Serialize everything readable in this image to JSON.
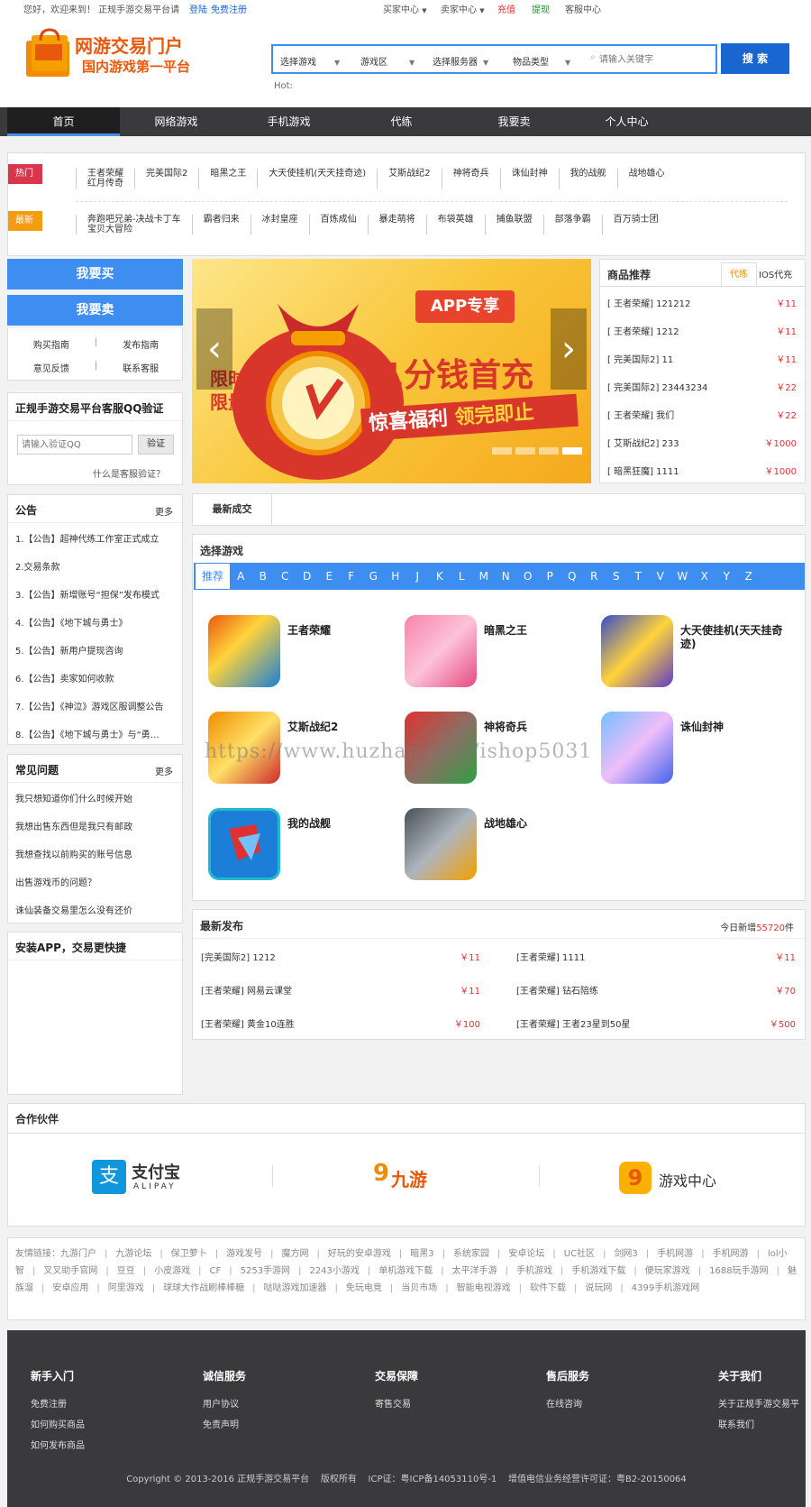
{
  "topbar": {
    "welcome": "您好，欢迎来到！ 正规手游交易平台请",
    "login": "登陆",
    "register": "免费注册",
    "buyer_center": "买家中心",
    "seller_center": "卖家中心",
    "recharge": "充值",
    "withdraw": "提现",
    "service_center": "客服中心"
  },
  "header": {
    "logo_title": "网游交易门户",
    "logo_subtitle": "国内游戏第一平台",
    "search": {
      "game_select": "选择游戏",
      "zone_select": "游戏区",
      "server_select": "选择服务器",
      "type_select": "物品类型",
      "placeholder": "请输入关键字",
      "button": "搜 索",
      "hot_label": "Hot:"
    }
  },
  "nav": [
    "首页",
    "网络游戏",
    "手机游戏",
    "代练",
    "我要卖",
    "个人中心"
  ],
  "hot": {
    "hot_label": "热门",
    "new_label": "最新",
    "hot_items": [
      "王者荣耀",
      "完美国际2",
      "暗黑之王",
      "大天使挂机(天天挂奇迹)",
      "艾斯战纪2",
      "神将奇兵",
      "诛仙封神",
      "我的战舰",
      "战地雄心"
    ],
    "hot_first_sub": "红月传奇",
    "new_items": [
      "奔跑吧兄弟-决战卡丁车",
      "霸者归来",
      "冰封皇座",
      "百炼成仙",
      "暴走萌将",
      "布袋英雄",
      "捕鱼联盟",
      "部落争霸",
      "百万骑士团"
    ],
    "new_first_sub": "宝贝大冒险"
  },
  "left": {
    "buy": "我要买",
    "sell": "我要卖",
    "links": [
      "购买指南",
      "发布指南",
      "意见反馈",
      "联系客服"
    ],
    "qq_title": "正规手游交易平台客服QQ验证",
    "qq_placeholder": "请输入验证QQ",
    "qq_button": "验证",
    "qq_help": "什么是客服验证？",
    "notice_title": "公告",
    "more": "更多",
    "notices": [
      "1.【公告】超神代练工作室正式成立",
      "2.交易条款",
      "3.【公告】新增账号“担保”发布模式",
      "4.【公告】《地下城与勇士》",
      "5.【公告】新用户提现咨询",
      "6.【公告】卖家如何收款",
      "7.【公告】《神泣》游戏区服调整公告",
      "8.【公告】《地下城与勇士》与“勇…"
    ],
    "faq_title": "常见问题",
    "faqs": [
      "我只想知道你们什么时候开始",
      "我想出售东西但是我只有邮政",
      "我想查找以前购买的账号信息",
      "出售游戏币的问题？",
      "诛仙装备交易里怎么没有还价"
    ],
    "app_title": "安装APP，交易更快捷"
  },
  "banner": {
    "badge": "APP专享",
    "headline": "1分钱首充",
    "sub": "惊喜福利",
    "sub2": "领完即止",
    "tag1": "限时",
    "tag2": "限量"
  },
  "recommend": {
    "title": "商品推荐",
    "tab1": "代练",
    "tab2": "IOS代充",
    "items": [
      {
        "name": "[ 王者荣耀] 121212",
        "price": "￥11"
      },
      {
        "name": "[ 王者荣耀] 1212",
        "price": "￥11"
      },
      {
        "name": "[ 完美国际2] 11",
        "price": "￥11"
      },
      {
        "name": "[ 完美国际2] 23443234",
        "price": "￥22"
      },
      {
        "name": "[ 王者荣耀] 我们",
        "price": "￥22"
      },
      {
        "name": "[ 艾斯战纪2] 233",
        "price": "￥1000"
      },
      {
        "name": "[ 暗黑狂魔] 1111",
        "price": "￥1000"
      }
    ]
  },
  "deals_tab": "最新成交",
  "select_game": {
    "title": "选择游戏",
    "recommend": "推荐",
    "letters": [
      "A",
      "B",
      "C",
      "D",
      "E",
      "F",
      "G",
      "H",
      "J",
      "K",
      "L",
      "M",
      "N",
      "O",
      "P",
      "Q",
      "R",
      "S",
      "T",
      "V",
      "W",
      "X",
      "Y",
      "Z"
    ],
    "games": [
      "王者荣耀",
      "暗黑之王",
      "大天使挂机(天天挂奇迹)",
      "艾斯战纪2",
      "神将奇兵",
      "诛仙封神",
      "我的战舰",
      "战地雄心"
    ],
    "watermark": "https://www.huzhan.com/ishop5031"
  },
  "latest": {
    "title": "最新发布",
    "today_prefix": "今日新增",
    "today_count": "55720",
    "today_suffix": "件",
    "left": [
      {
        "name": "[完美国际2] 1212",
        "price": "￥11"
      },
      {
        "name": "[王者荣耀] 网易云课堂",
        "price": "￥11"
      },
      {
        "name": "[王者荣耀] 黄金10连胜",
        "price": "￥100"
      }
    ],
    "right": [
      {
        "name": "[王者荣耀] 1111",
        "price": "￥11"
      },
      {
        "name": "[王者荣耀] 钻石陪练",
        "price": "￥70"
      },
      {
        "name": "[王者荣耀] 王者23星到50星",
        "price": "￥500"
      }
    ]
  },
  "partners": {
    "title": "合作伙伴",
    "alipay": "支付宝",
    "alipay_en": "ALIPAY",
    "jiuyou": "九游",
    "game_center": "游戏中心"
  },
  "friend_links": {
    "label": "友情链接：",
    "items": [
      "九游门户",
      "九游论坛",
      "保卫萝卜",
      "游戏发号",
      "魔方网",
      "好玩的安卓游戏",
      "暗黑3",
      "系统家园",
      "安卓论坛",
      "UC社区",
      "剑网3",
      "手机网游",
      "手机网游",
      "lol小智",
      "叉叉助手官网",
      "豆豆",
      "小皮游戏",
      "CF",
      "5253手游网",
      "2243小游戏",
      "单机游戏下载",
      "太平洋手游",
      "手机游戏",
      "手机游戏下载",
      "便玩家游戏",
      "1688玩手游网",
      "魅族溜",
      "安卓应用",
      "阿里游戏",
      "球球大作战刷棒棒糖",
      "哒哒游戏加速器",
      "免玩电竞",
      "当贝市场",
      "智能电视游戏",
      "软件下载",
      "说玩网",
      "4399手机游戏网"
    ]
  },
  "footer": {
    "cols": [
      {
        "title": "新手入门",
        "items": [
          "免费注册",
          "如何购买商品",
          "如何发布商品"
        ]
      },
      {
        "title": "诚信服务",
        "items": [
          "用户协议",
          "免责声明"
        ]
      },
      {
        "title": "交易保障",
        "items": [
          "寄售交易"
        ]
      },
      {
        "title": "售后服务",
        "items": [
          "在线咨询"
        ]
      },
      {
        "title": "关于我们",
        "items": [
          "关于正规手游交易平",
          "联系我们"
        ]
      }
    ],
    "copyright": "Copyright © 2013-2016 正规手游交易平台    版权所有    ICP证：粤ICP备14053110号-1    增值电信业务经营许可证：粤B2-20150064"
  }
}
